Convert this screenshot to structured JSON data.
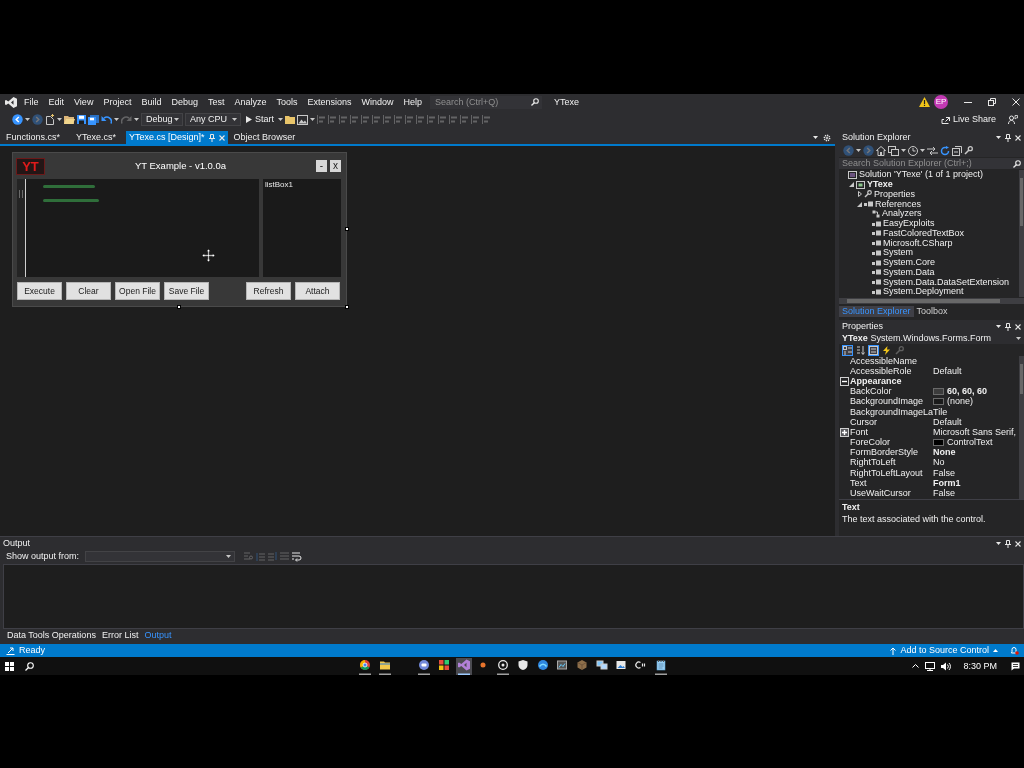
{
  "window": {
    "title": "YTexe"
  },
  "menu": [
    "File",
    "Edit",
    "View",
    "Project",
    "Build",
    "Debug",
    "Test",
    "Analyze",
    "Tools",
    "Extensions",
    "Window",
    "Help"
  ],
  "search": {
    "placeholder": "Search (Ctrl+Q)"
  },
  "account": {
    "initials": "EP"
  },
  "toolbar": {
    "items": [
      {
        "kind": "back",
        "disabled": false
      },
      {
        "kind": "forward",
        "disabled": true
      },
      {
        "kind": "new_item",
        "disabled": false
      },
      {
        "kind": "open",
        "disabled": false
      },
      {
        "kind": "save",
        "disabled": false
      },
      {
        "kind": "save_all",
        "disabled": false
      },
      {
        "kind": "undo",
        "disabled": false
      },
      {
        "kind": "redo",
        "disabled": true
      },
      {
        "kind": "configuration",
        "label": "Debug"
      },
      {
        "kind": "platform",
        "label": "Any CPU"
      },
      {
        "kind": "start",
        "label": "Start"
      },
      {
        "kind": "folder",
        "disabled": false
      },
      {
        "kind": "image",
        "disabled": false
      },
      {
        "kind": "align",
        "disabled": true
      },
      {
        "kind": "align",
        "disabled": true
      },
      {
        "kind": "align",
        "disabled": true
      },
      {
        "kind": "align",
        "disabled": true
      },
      {
        "kind": "align",
        "disabled": true
      },
      {
        "kind": "align",
        "disabled": true
      },
      {
        "kind": "align",
        "disabled": true
      },
      {
        "kind": "align",
        "disabled": true
      },
      {
        "kind": "align",
        "disabled": true
      },
      {
        "kind": "align",
        "disabled": true
      },
      {
        "kind": "align",
        "disabled": true
      },
      {
        "kind": "align",
        "disabled": true
      },
      {
        "kind": "align",
        "disabled": true
      },
      {
        "kind": "align",
        "disabled": true
      },
      {
        "kind": "align",
        "disabled": true
      },
      {
        "kind": "align",
        "disabled": true
      }
    ],
    "live_share": "Live Share"
  },
  "document_tabs": [
    {
      "label": "Functions.cs*",
      "selected": false
    },
    {
      "label": "YTexe.cs*",
      "selected": false
    },
    {
      "label": "YTexe.cs [Design]*",
      "selected": true
    },
    {
      "label": "Object Browser",
      "selected": false
    }
  ],
  "designer": {
    "form": {
      "logo": "YT",
      "title": "YT Example - v1.0.0a",
      "window_buttons": [
        "-",
        "x"
      ],
      "list_box": "listBox1",
      "left_buttons": [
        "Execute",
        "Clear",
        "Open File",
        "Save File"
      ],
      "right_buttons": [
        "Refresh",
        "Attach"
      ]
    }
  },
  "solution_explorer": {
    "title": "Solution Explorer",
    "toolbar": [
      {
        "kind": "back",
        "disabled": true
      },
      {
        "kind": "forward",
        "disabled": true
      },
      {
        "kind": "home",
        "disabled": false
      },
      {
        "kind": "views",
        "disabled": false
      },
      {
        "kind": "pending",
        "disabled": false
      },
      {
        "kind": "sync",
        "disabled": false
      },
      {
        "kind": "refresh",
        "disabled": false
      },
      {
        "kind": "collapse",
        "disabled": false
      },
      {
        "kind": "properties",
        "disabled": false
      }
    ],
    "search": {
      "placeholder": "Search Solution Explorer (Ctrl+;)"
    },
    "tree": [
      {
        "label": "Solution 'YTexe' (1 of 1 project)",
        "kind": "solution",
        "children": [
          {
            "label": "YTexe",
            "kind": "project",
            "expanded": true,
            "children": [
              {
                "label": "Properties",
                "kind": "properties",
                "expanded": false
              },
              {
                "label": "References",
                "kind": "references",
                "expanded": true,
                "children": [
                  {
                    "label": "Analyzers",
                    "kind": "analyzers"
                  },
                  {
                    "label": "EasyExploits",
                    "kind": "reference"
                  },
                  {
                    "label": "FastColoredTextBox",
                    "kind": "reference"
                  },
                  {
                    "label": "Microsoft.CSharp",
                    "kind": "reference"
                  },
                  {
                    "label": "System",
                    "kind": "reference"
                  },
                  {
                    "label": "System.Core",
                    "kind": "reference"
                  },
                  {
                    "label": "System.Data",
                    "kind": "reference"
                  },
                  {
                    "label": "System.Data.DataSetExtension",
                    "kind": "reference"
                  },
                  {
                    "label": "System.Deployment",
                    "kind": "reference"
                  }
                ]
              }
            ]
          }
        ]
      }
    ]
  },
  "side_tabs": [
    {
      "label": "Solution Explorer",
      "selected": true
    },
    {
      "label": "Toolbox",
      "selected": false
    }
  ],
  "properties": {
    "title": "Properties",
    "object": "YTexe",
    "type": "System.Windows.Forms.Form",
    "view_buttons": [
      {
        "kind": "categorized",
        "selected": true,
        "disabled": false
      },
      {
        "kind": "alphabetical",
        "selected": false,
        "disabled": false
      },
      {
        "kind": "property_view",
        "selected": true,
        "disabled": false
      },
      {
        "kind": "events",
        "selected": false,
        "disabled": false
      },
      {
        "kind": "property_pages",
        "selected": false,
        "disabled": true
      }
    ],
    "rows": [
      {
        "kind": "property",
        "name": "AccessibleName"
      },
      {
        "kind": "property",
        "name": "AccessibleRole",
        "value": "Default",
        "modified": false
      },
      {
        "kind": "category",
        "name": "Appearance",
        "expanded": true
      },
      {
        "kind": "color",
        "name": "BackColor",
        "value": "60, 60, 60",
        "color": "#3c3c3c",
        "modified": true
      },
      {
        "kind": "image",
        "name": "BackgroundImage",
        "value": "(none)",
        "modified": false
      },
      {
        "kind": "property",
        "name": "BackgroundImageLa",
        "value": "Tile",
        "modified": false
      },
      {
        "kind": "property",
        "name": "Cursor",
        "value": "Default",
        "modified": false
      },
      {
        "kind": "property",
        "name": "Font",
        "value": "Microsoft Sans Serif,",
        "expanded": false,
        "modified": false
      },
      {
        "kind": "color",
        "name": "ForeColor",
        "value": "ControlText",
        "color": "#000000",
        "modified": false
      },
      {
        "kind": "property",
        "name": "FormBorderStyle",
        "value": "None",
        "modified": true
      },
      {
        "kind": "property",
        "name": "RightToLeft",
        "value": "No",
        "modified": false
      },
      {
        "kind": "property",
        "name": "RightToLeftLayout",
        "value": "False",
        "modified": false
      },
      {
        "kind": "property",
        "name": "Text",
        "value": "Form1",
        "modified": true
      },
      {
        "kind": "property",
        "name": "UseWaitCursor",
        "value": "False",
        "modified": false
      }
    ],
    "description": {
      "title": "Text",
      "text": "The text associated with the control."
    }
  },
  "output": {
    "title": "Output",
    "show_from": "Show output from:",
    "toolbar": [
      {
        "kind": "goto",
        "disabled": true
      },
      {
        "kind": "prev",
        "disabled": true
      },
      {
        "kind": "next",
        "disabled": true
      },
      {
        "kind": "clear",
        "disabled": true
      },
      {
        "kind": "wrap",
        "disabled": false
      }
    ]
  },
  "bottom_tabs": [
    {
      "label": "Data Tools Operations",
      "selected": false
    },
    {
      "label": "Error List",
      "selected": false
    },
    {
      "label": "Output",
      "selected": true
    }
  ],
  "status_bar": {
    "text": "Ready",
    "source_control": "Add to Source Control"
  },
  "taskbar": {
    "apps": [
      {
        "kind": "browser",
        "selected": false,
        "running": true
      },
      {
        "kind": "files",
        "selected": false,
        "running": true
      },
      {
        "kind": "chat",
        "selected": false,
        "running": true
      },
      {
        "kind": "grid",
        "selected": false,
        "running": false
      },
      {
        "kind": "studio",
        "selected": true,
        "running": true
      },
      {
        "kind": "dot",
        "selected": false,
        "running": false
      },
      {
        "kind": "ring",
        "selected": false,
        "running": true
      },
      {
        "kind": "shield",
        "selected": false,
        "running": false
      },
      {
        "kind": "wave",
        "selected": false,
        "running": false
      },
      {
        "kind": "window",
        "selected": false,
        "running": false
      },
      {
        "kind": "box",
        "selected": false,
        "running": false
      },
      {
        "kind": "monitors",
        "selected": false,
        "running": false
      },
      {
        "kind": "picture",
        "selected": false,
        "running": false
      },
      {
        "kind": "swirl",
        "selected": false,
        "running": false
      },
      {
        "kind": "notepad",
        "selected": false,
        "running": true
      }
    ],
    "time": "8:30 PM"
  }
}
